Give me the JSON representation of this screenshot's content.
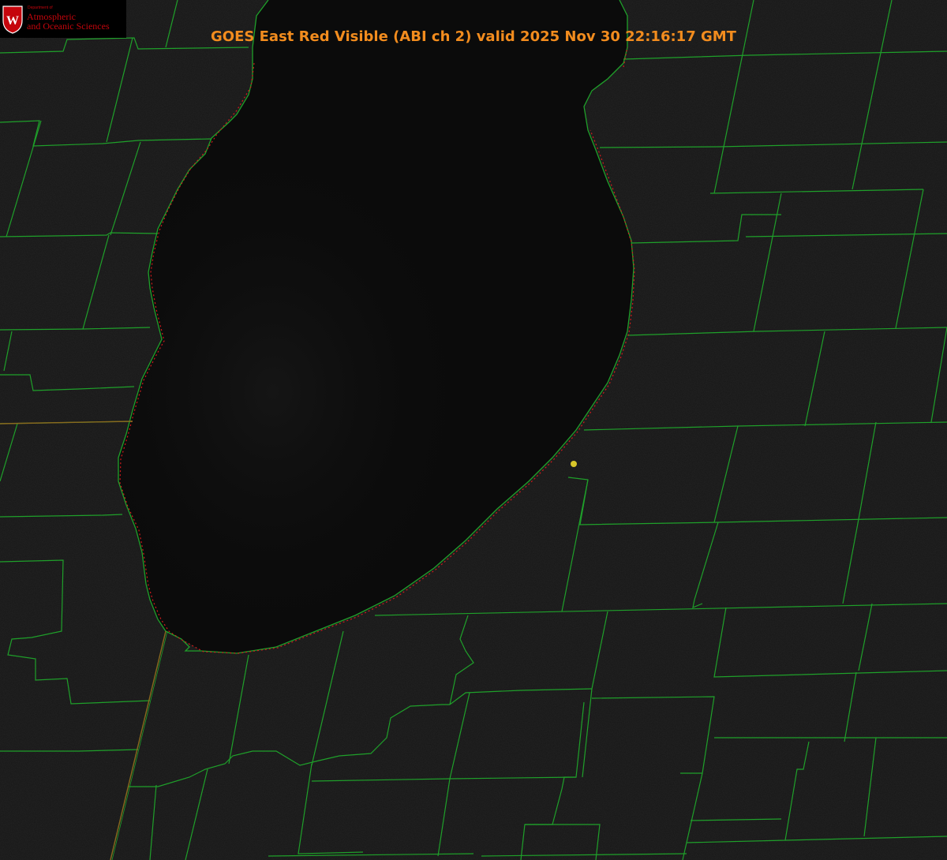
{
  "header": {
    "title": "GOES East Red Visible (ABI ch 2) valid 2025 Nov 30 22:16:17 GMT"
  },
  "logo": {
    "dept_small": "Department of",
    "dept_line1": "Atmospheric",
    "dept_line2": "and Oceanic Sciences",
    "seal_letter": "W"
  },
  "map": {
    "colors": {
      "background": "#000000",
      "lake": "#0b0b0b",
      "land": "#161616",
      "county_lines": "#1fa02a",
      "shoreline_dots": "#d01c1c",
      "title": "#f28c1e",
      "marker": "#d8c62a",
      "logo_text": "#c5050c"
    },
    "markers": [
      {
        "name": "location-marker",
        "color": "#d8c62a"
      }
    ]
  }
}
